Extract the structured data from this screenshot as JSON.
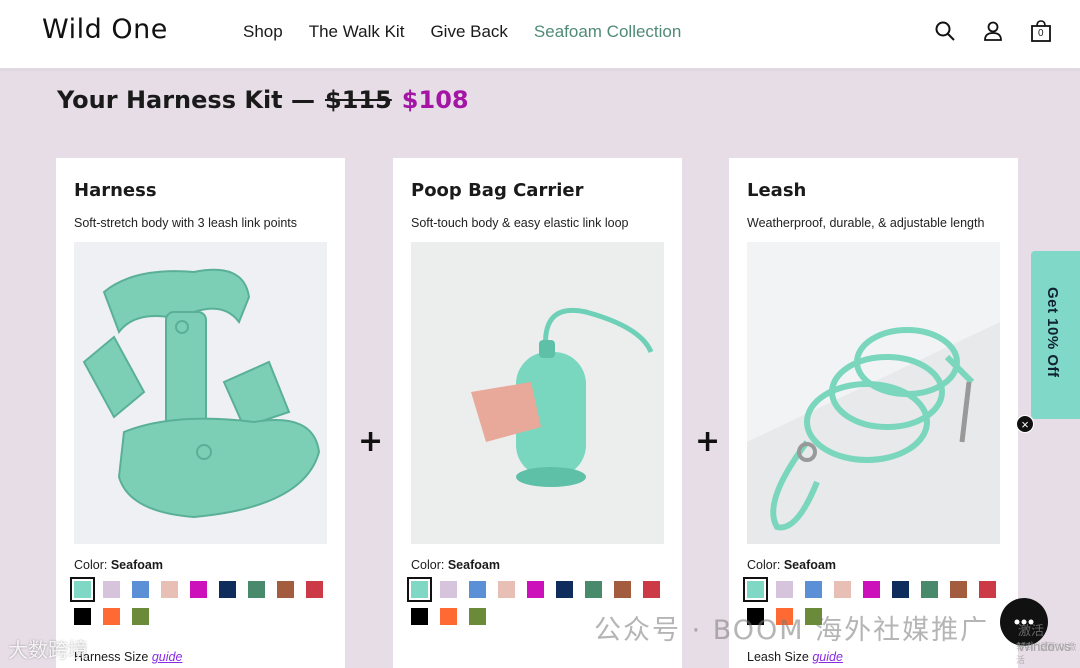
{
  "header": {
    "logo": "Wild One",
    "nav": [
      {
        "label": "Shop"
      },
      {
        "label": "The Walk Kit"
      },
      {
        "label": "Give Back"
      },
      {
        "label": "Seafoam Collection"
      }
    ],
    "cart_count": "0",
    "icons": [
      "search-icon",
      "account-icon",
      "cart-icon"
    ]
  },
  "kit": {
    "title": "Your Harness Kit —",
    "old_price": "$115",
    "new_price": "$108"
  },
  "cards": [
    {
      "title": "Harness",
      "subtitle": "Soft-stretch body with 3 leash link points",
      "color_label": "Color:",
      "color_value": "Seafoam",
      "size_label": "Harness Size",
      "size_link": "guide"
    },
    {
      "title": "Poop Bag Carrier",
      "subtitle": "Soft-touch body & easy elastic link loop",
      "color_label": "Color:",
      "color_value": "Seafoam",
      "size_label": "",
      "size_link": ""
    },
    {
      "title": "Leash",
      "subtitle": "Weatherproof, durable, & adjustable length",
      "color_label": "Color:",
      "color_value": "Seafoam",
      "size_label": "Leash Size",
      "size_link": "guide"
    }
  ],
  "swatch_colors": [
    "#7fd8c4",
    "#d6c4dd",
    "#5b8fd6",
    "#e8bfb5",
    "#cc11bb",
    "#0e2d5c",
    "#4a8a6c",
    "#a35c3e",
    "#cc3a48",
    "#000000",
    "#ff6a33",
    "#6b8a3a"
  ],
  "plus_sign": "+",
  "promo": {
    "label": "Get 10% Off",
    "close": "×"
  },
  "watermarks": {
    "wechat": "公众号 · BOOM 海外社媒推广",
    "brand": "大数跨境",
    "windows": "激活 Windows",
    "windows_sub": "转到\"设置\"以激活"
  },
  "colors": {
    "accent_green": "#4f8a78",
    "price_purple": "#a515a5",
    "page_bg": "#e6dde6",
    "promo_bg": "#7fd8c8"
  }
}
